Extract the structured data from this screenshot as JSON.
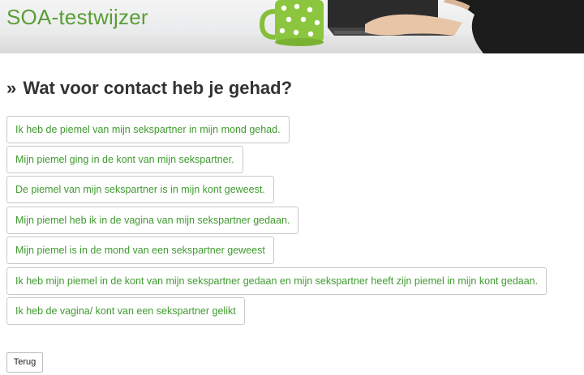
{
  "header": {
    "site_title": "SOA-testwijzer"
  },
  "question": {
    "marker": "»",
    "text": "Wat voor contact heb je gehad?"
  },
  "answers": [
    {
      "label": "Ik heb de piemel van mijn sekspartner in mijn mond gehad."
    },
    {
      "label": "Mijn piemel ging in de kont van mijn sekspartner."
    },
    {
      "label": "De piemel van mijn sekspartner is in mijn kont geweest."
    },
    {
      "label": "Mijn piemel heb ik in de vagina van mijn sekspartner gedaan."
    },
    {
      "label": "Mijn piemel is in de mond van een sekspartner geweest"
    },
    {
      "label": "Ik heb mijn piemel in de kont van mijn sekspartner gedaan en mijn sekspartner heeft zijn piemel in mijn kont gedaan."
    },
    {
      "label": "Ik heb de vagina/ kont van een sekspartner gelikt"
    }
  ],
  "footer": {
    "back_label": "Terug"
  },
  "colors": {
    "brand_green": "#5a9e35",
    "answer_text": "#3f9a2f",
    "question_text": "#333333"
  }
}
